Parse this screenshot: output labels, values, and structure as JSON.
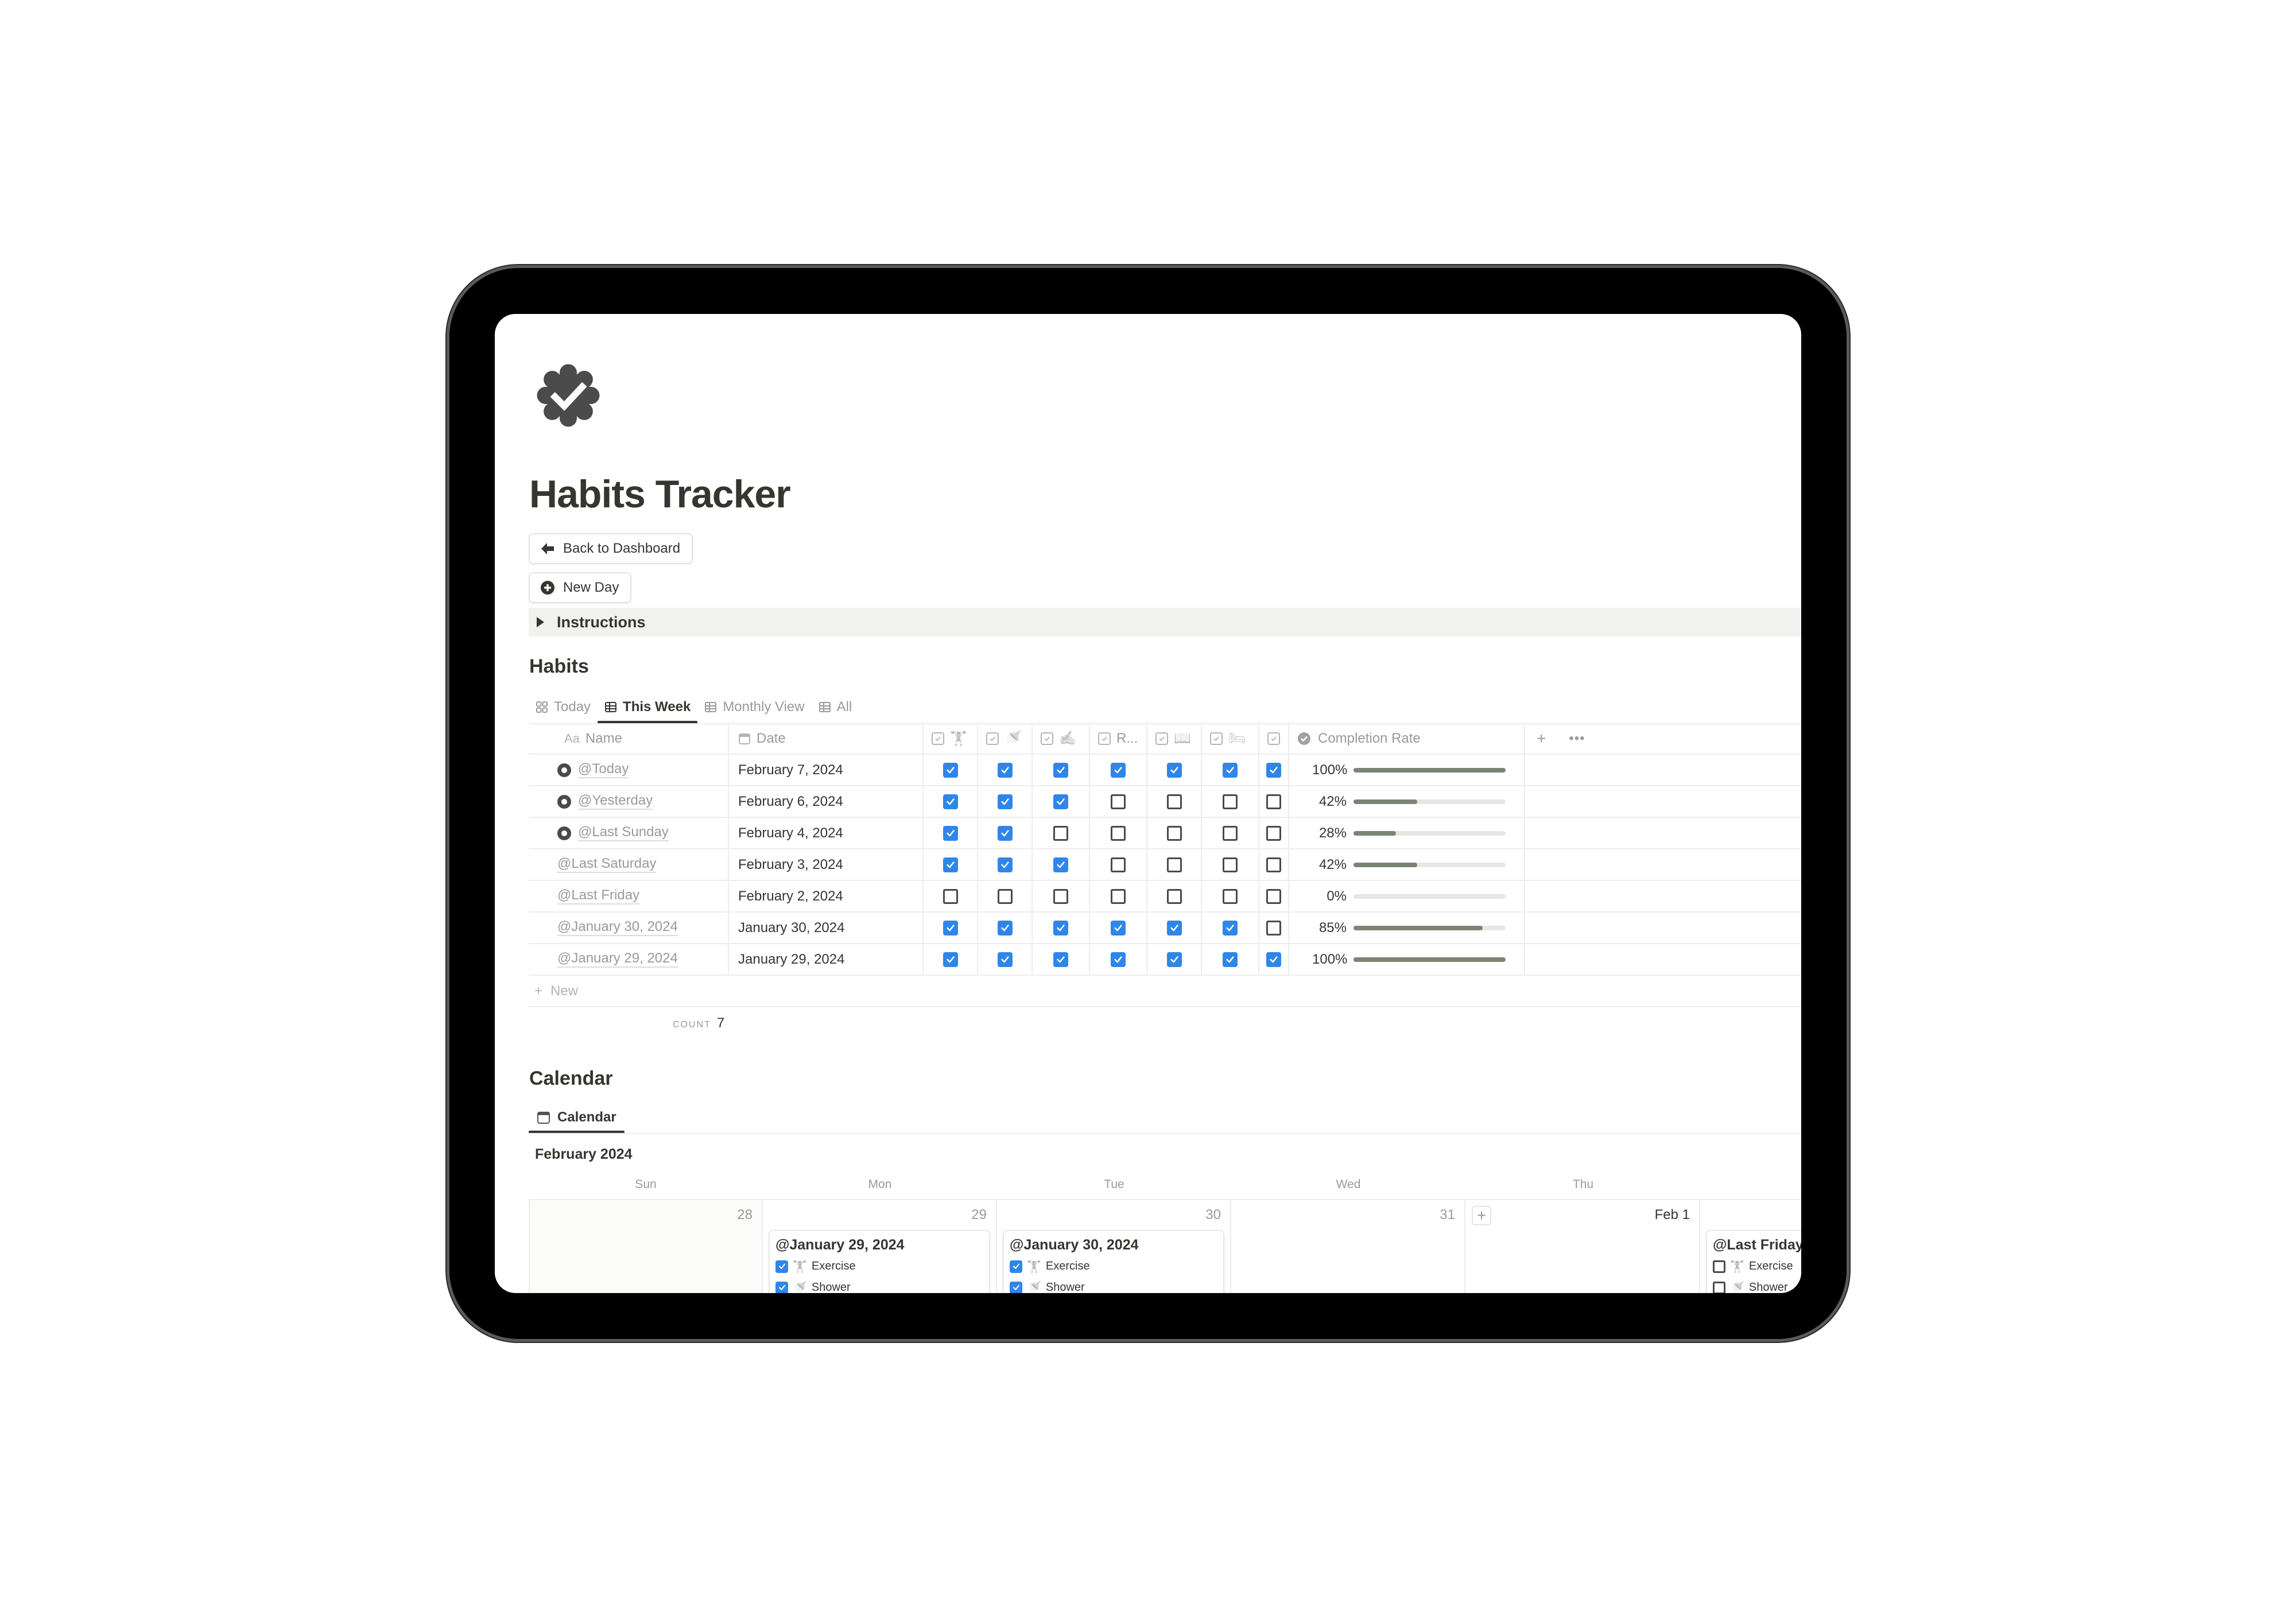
{
  "page": {
    "title": "Habits Tracker",
    "icon": "verified-badge-check-icon"
  },
  "buttons": {
    "back_label": "Back to Dashboard",
    "new_day_label": "New Day"
  },
  "toggle": {
    "label": "Instructions",
    "expanded": false
  },
  "habits": {
    "heading": "Habits",
    "tabs": [
      {
        "label": "Today",
        "icon": "gallery-icon",
        "active": false
      },
      {
        "label": "This Week",
        "icon": "table-icon",
        "active": true
      },
      {
        "label": "Monthly View",
        "icon": "table-icon",
        "active": false
      },
      {
        "label": "All",
        "icon": "table-icon",
        "active": false
      }
    ],
    "columns": {
      "name": {
        "prefix": "Aa",
        "label": "Name"
      },
      "date": {
        "label": "Date"
      },
      "habits": [
        {
          "emoji": "🏋",
          "label": "",
          "semantic": "exercise"
        },
        {
          "emoji": "🚿",
          "label": "",
          "semantic": "shower"
        },
        {
          "emoji": "✍",
          "label": "",
          "semantic": "journal"
        },
        {
          "emoji": "",
          "label": "R...",
          "semantic": "truncated-habit"
        },
        {
          "emoji": "📖",
          "label": "",
          "semantic": "read"
        },
        {
          "emoji": "🛏",
          "label": "",
          "semantic": "sleep"
        },
        {
          "emoji": "",
          "label": "",
          "semantic": "unnamed-habit"
        }
      ],
      "completion": {
        "label": "Completion Rate"
      }
    },
    "rows": [
      {
        "name": "@Today",
        "has_icon": true,
        "date": "February 7, 2024",
        "checks": [
          true,
          true,
          true,
          true,
          true,
          true,
          true
        ],
        "rate_text": "100%",
        "rate": 1.0
      },
      {
        "name": "@Yesterday",
        "has_icon": true,
        "date": "February 6, 2024",
        "checks": [
          true,
          true,
          true,
          false,
          false,
          false,
          false
        ],
        "rate_text": "42%",
        "rate": 0.42
      },
      {
        "name": "@Last Sunday",
        "has_icon": true,
        "date": "February 4, 2024",
        "checks": [
          true,
          true,
          false,
          false,
          false,
          false,
          false
        ],
        "rate_text": "28%",
        "rate": 0.28
      },
      {
        "name": "@Last Saturday",
        "has_icon": false,
        "date": "February 3, 2024",
        "checks": [
          true,
          true,
          true,
          false,
          false,
          false,
          false
        ],
        "rate_text": "42%",
        "rate": 0.42
      },
      {
        "name": "@Last Friday",
        "has_icon": false,
        "date": "February 2, 2024",
        "checks": [
          false,
          false,
          false,
          false,
          false,
          false,
          false
        ],
        "rate_text": "0%",
        "rate": 0.0
      },
      {
        "name": "@January 30, 2024",
        "has_icon": false,
        "date": "January 30, 2024",
        "checks": [
          true,
          true,
          true,
          true,
          true,
          true,
          false
        ],
        "rate_text": "85%",
        "rate": 0.85
      },
      {
        "name": "@January 29, 2024",
        "has_icon": false,
        "date": "January 29, 2024",
        "checks": [
          true,
          true,
          true,
          true,
          true,
          true,
          true
        ],
        "rate_text": "100%",
        "rate": 1.0
      }
    ],
    "new_label": "New",
    "count_label": "COUNT",
    "count_value": "7"
  },
  "calendar": {
    "heading": "Calendar",
    "tab_label": "Calendar",
    "month": "February 2024",
    "days_of_week": [
      "Sun",
      "Mon",
      "Tue",
      "Wed",
      "Thu"
    ],
    "cells": [
      {
        "day": "28",
        "weekend": true,
        "month_start": false,
        "add_button": false,
        "card": null
      },
      {
        "day": "29",
        "weekend": false,
        "month_start": false,
        "add_button": false,
        "card": {
          "title": "@January 29, 2024",
          "items": [
            {
              "emoji": "🏋",
              "label": "Exercise",
              "checked": true
            },
            {
              "emoji": "🚿",
              "label": "Shower",
              "checked": true
            }
          ]
        }
      },
      {
        "day": "30",
        "weekend": false,
        "month_start": false,
        "add_button": false,
        "card": {
          "title": "@January 30, 2024",
          "items": [
            {
              "emoji": "🏋",
              "label": "Exercise",
              "checked": true
            },
            {
              "emoji": "🚿",
              "label": "Shower",
              "checked": true
            }
          ]
        }
      },
      {
        "day": "31",
        "weekend": false,
        "month_start": false,
        "add_button": false,
        "card": null
      },
      {
        "day": "Feb 1",
        "weekend": false,
        "month_start": true,
        "add_button": true,
        "card": null
      },
      {
        "day": "",
        "weekend": false,
        "month_start": false,
        "add_button": false,
        "card": {
          "title": "@Last Friday",
          "items": [
            {
              "emoji": "🏋",
              "label": "Exercise",
              "checked": false
            },
            {
              "emoji": "🚿",
              "label": "Shower",
              "checked": false
            }
          ]
        }
      }
    ],
    "add_symbol": "+"
  },
  "colors": {
    "checkbox_checked": "#2f86e8",
    "progress_fill": "#7a8575",
    "progress_track": "#e6e6e4",
    "toggle_bg": "#f1f1ef",
    "text_primary": "#37352f",
    "text_muted": "#9b9a97"
  }
}
